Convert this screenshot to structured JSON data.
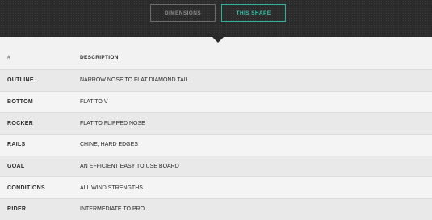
{
  "tabs": {
    "dimensions": "DIMENSIONS",
    "this_shape": "THIS SHAPE"
  },
  "table": {
    "headers": [
      "#",
      "DESCRIPTION"
    ],
    "rows": [
      {
        "label": "OUTLINE",
        "value": "NARROW NOSE TO FLAT DIAMOND TAIL"
      },
      {
        "label": "BOTTOM",
        "value": "FLAT TO V"
      },
      {
        "label": "ROCKER",
        "value": "FLAT TO FLIPPED NOSE"
      },
      {
        "label": "RAILS",
        "value": "CHINE, HARD EDGES"
      },
      {
        "label": "GOAL",
        "value": "AN EFFICIENT EASY TO USE BOARD"
      },
      {
        "label": "CONDITIONS",
        "value": "ALL WIND STRENGTHS"
      },
      {
        "label": "RIDER",
        "value": "INTERMEDIATE TO PRO"
      }
    ]
  }
}
